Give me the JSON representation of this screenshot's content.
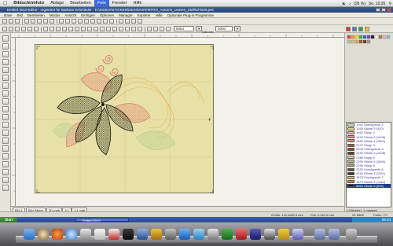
{
  "mac_menubar": {
    "apple": "",
    "items": [
      "Bildschirmfoto",
      "Ablage",
      "Bearbeiten",
      "Foto",
      "Fenster",
      "Hilfe"
    ],
    "highlighted": "Foto",
    "battery": "(95 %)",
    "clock": "So. 10:26"
  },
  "window": {
    "title": "Embird 2010 Editor - registriert für Barbara Schmieder - D:\\Sticken\\STICKEN\\DESIGNS\\PMTRO_Autumn_Leaves_Stoffschl130.pes"
  },
  "app_menu": [
    "Datei",
    "Bild",
    "Bearbeiten",
    "Modus",
    "Ansicht",
    "Einfügen",
    "Optionen",
    "Manager",
    "Explorer",
    "Hilfe",
    "Optionale Plug-in Programme"
  ],
  "toolbar2": {
    "hoop_field": "5064",
    "value_field": "0000",
    "unit": "Millimeter"
  },
  "color_list": [
    {
      "code": "1042",
      "name": "Sonnigrecht 2",
      "color": "#d4e4a4"
    },
    {
      "code": "1043",
      "name": "Stiche 3 (420)",
      "color": "#f0d070"
    },
    {
      "code": "1462",
      "name": "Stopp 2",
      "color": "#f4b0a8"
    },
    {
      "code": "1463",
      "name": "Stiche 3 (1408)",
      "color": "#f08a7c"
    },
    {
      "code": "1465",
      "name": "Stiche 4 (1854)",
      "color": "#e98a60"
    },
    {
      "code": "2170",
      "name": "Stopp 4",
      "color": "#b25a3a"
    },
    {
      "code": "2205",
      "name": "Sonnigrecht 4",
      "color": "#8a4a2a"
    },
    {
      "code": "2190",
      "name": "Stiche 3 (1408)",
      "color": "#6a3820"
    },
    {
      "code": "2186",
      "name": "Stopp 5",
      "color": "#e0d0a0"
    },
    {
      "code": "2195",
      "name": "Stiche 5 (1895)",
      "color": "#c8b888"
    },
    {
      "code": "2196",
      "name": "Stopp 6",
      "color": "#aa9c6a"
    },
    {
      "code": "2235",
      "name": "Sonnigrecht 6",
      "color": "#6a5a3a"
    },
    {
      "code": "4240",
      "name": "Stiche 7 (1031)",
      "color": "#4a3a22"
    },
    {
      "code": "1678",
      "name": "Sonnigrecht 7",
      "color": "#e8c070"
    },
    {
      "code": "1679",
      "name": "Stiche 8 (1264)",
      "color": "#c09040"
    },
    {
      "code": "5064",
      "name": "Stiche 9 (915)",
      "color": "#222222",
      "selected": true
    }
  ],
  "right_panel": {
    "info1": "1 Objekt(e), 1 markiert",
    "info2": "19,3 : 59,0 mm, 100%"
  },
  "tabs": [
    "Bild 1",
    "Bild Stiche",
    "3D matt",
    "1:1",
    "1:1 matt"
  ],
  "status": {
    "size": "Größe: 112,4x89,4 mm",
    "pos": "Pos: 0,0x0,0 mm",
    "stitches": "St: 6800",
    "page": "Farbe: 7/7"
  },
  "taskbar": {
    "start": "Start",
    "task": "Embird 2010",
    "clock": "09:24"
  },
  "colors": {
    "hoop": "#e7e1a8",
    "accent": "#24437a"
  }
}
